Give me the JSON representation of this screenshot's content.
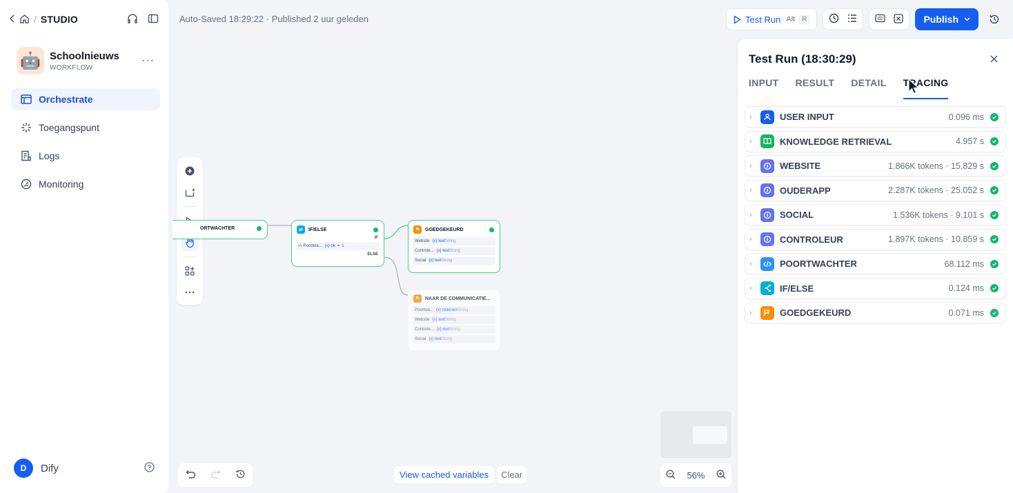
{
  "nav": {
    "studio": "STUDIO"
  },
  "app": {
    "name": "Schoolnieuws",
    "type": "WORKFLOW",
    "icon": "robot-emoji"
  },
  "sidebar": {
    "items": [
      {
        "label": "Orchestrate",
        "icon": "layout-icon",
        "active": true
      },
      {
        "label": "Toegangspunt",
        "icon": "spark-icon"
      },
      {
        "label": "Logs",
        "icon": "logs-icon"
      },
      {
        "label": "Monitoring",
        "icon": "gauge-icon"
      }
    ]
  },
  "user": {
    "initial": "D",
    "name": "Dify"
  },
  "status": "Auto-Saved 18:29:22 · Published 2 uur geleden",
  "header": {
    "test_run": "Test Run",
    "alt": "Alt",
    "r": "R",
    "publish": "Publish"
  },
  "nodes": {
    "poortwachter": {
      "title": "ORTWACHTER"
    },
    "ifelse": {
      "title": "IF/ELSE",
      "if": "IF",
      "else": "ELSE",
      "cond_var": "Poortwa...",
      "cond_field": "{x} ok",
      "cond_op": "=",
      "cond_val": "1"
    },
    "goedgekeurd": {
      "title": "GOEDGEKEURD",
      "vars": [
        {
          "name": "Website",
          "field": "{x} text",
          "type": "String"
        },
        {
          "name": "Controle...",
          "field": "{x} text",
          "type": "String"
        },
        {
          "name": "Social",
          "field": "{x} text",
          "type": "String"
        }
      ]
    },
    "communicatie": {
      "title": "NAAR DE COMMUNICATIE...",
      "vars": [
        {
          "name": "Poortwa...",
          "field": "{x} redenen",
          "type": "String"
        },
        {
          "name": "Website",
          "field": "{x} text",
          "type": "String"
        },
        {
          "name": "Controle...",
          "field": "{x} text",
          "type": "String"
        },
        {
          "name": "Social",
          "field": "{x} text",
          "type": "String"
        }
      ]
    }
  },
  "cache": {
    "view": "View cached variables",
    "clear": "Clear"
  },
  "zoom": {
    "level": "56%"
  },
  "panel": {
    "title": "Test Run (18:30:29)",
    "tabs": [
      "INPUT",
      "RESULT",
      "DETAIL",
      "TRACING"
    ],
    "active_tab": "TRACING",
    "traces": [
      {
        "name": "USER INPUT",
        "meta": "0.096 ms",
        "color": "#155eef",
        "icon": "user-icon"
      },
      {
        "name": "KNOWLEDGE RETRIEVAL",
        "meta": "4.957 s",
        "color": "#16b364",
        "icon": "book-icon"
      },
      {
        "name": "WEBSITE",
        "meta": "1.866K tokens · 15.829 s",
        "color": "#6172f3",
        "icon": "llm-icon"
      },
      {
        "name": "OUDERAPP",
        "meta": "2.287K tokens · 25.052 s",
        "color": "#6172f3",
        "icon": "llm-icon"
      },
      {
        "name": "SOCIAL",
        "meta": "1.536K tokens · 9.101 s",
        "color": "#6172f3",
        "icon": "llm-icon"
      },
      {
        "name": "CONTROLEUR",
        "meta": "1.897K tokens · 10.859 s",
        "color": "#6172f3",
        "icon": "llm-icon"
      },
      {
        "name": "POORTWACHTER",
        "meta": "68.112 ms",
        "color": "#2e90fa",
        "icon": "code-icon"
      },
      {
        "name": "IF/ELSE",
        "meta": "0.124 ms",
        "color": "#06aed4",
        "icon": "branch-icon"
      },
      {
        "name": "GOEDGEKEURD",
        "meta": "0.071 ms",
        "color": "#f79009",
        "icon": "end-icon"
      }
    ]
  }
}
